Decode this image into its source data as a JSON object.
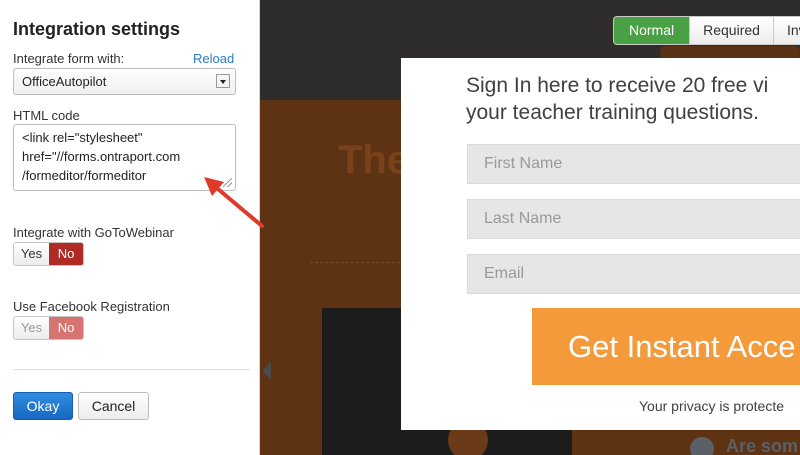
{
  "panel": {
    "title": "Integration settings",
    "integrate_label": "Integrate form with:",
    "reload_label": "Reload",
    "integration_select": "OfficeAutopilot",
    "html_code_label": "HTML code",
    "html_code_lines": [
      "<link rel=\"stylesheet\"",
      "href=\"//forms.ontraport.com",
      "/formeditor/formeditor"
    ],
    "gotowebinar_label": "Integrate with GoToWebinar",
    "gotowebinar_yes": "Yes",
    "gotowebinar_no": "No",
    "facebook_label": "Use Facebook Registration",
    "facebook_yes": "Yes",
    "facebook_no": "No",
    "okay_button": "Okay",
    "cancel_button": "Cancel"
  },
  "view_toggle": {
    "normal": "Normal",
    "required": "Required",
    "invisible": "Inv"
  },
  "form": {
    "headline_line1": "Sign In here to receive 20 free vi",
    "headline_line2": "your teacher training questions.",
    "first_name_placeholder": "First Name",
    "last_name_placeholder": "Last Name",
    "email_placeholder": "Email",
    "cta_label": "Get Instant Acce",
    "privacy_text": "Your privacy is protecte"
  },
  "background": {
    "heading": "The",
    "question": "Are som"
  },
  "colors": {
    "active_green": "#4aa045",
    "no_red": "#b02a26",
    "okay_blue": "#1f7ad3",
    "cta_orange": "#f49a3a",
    "annotation_red": "#e03a2a"
  }
}
